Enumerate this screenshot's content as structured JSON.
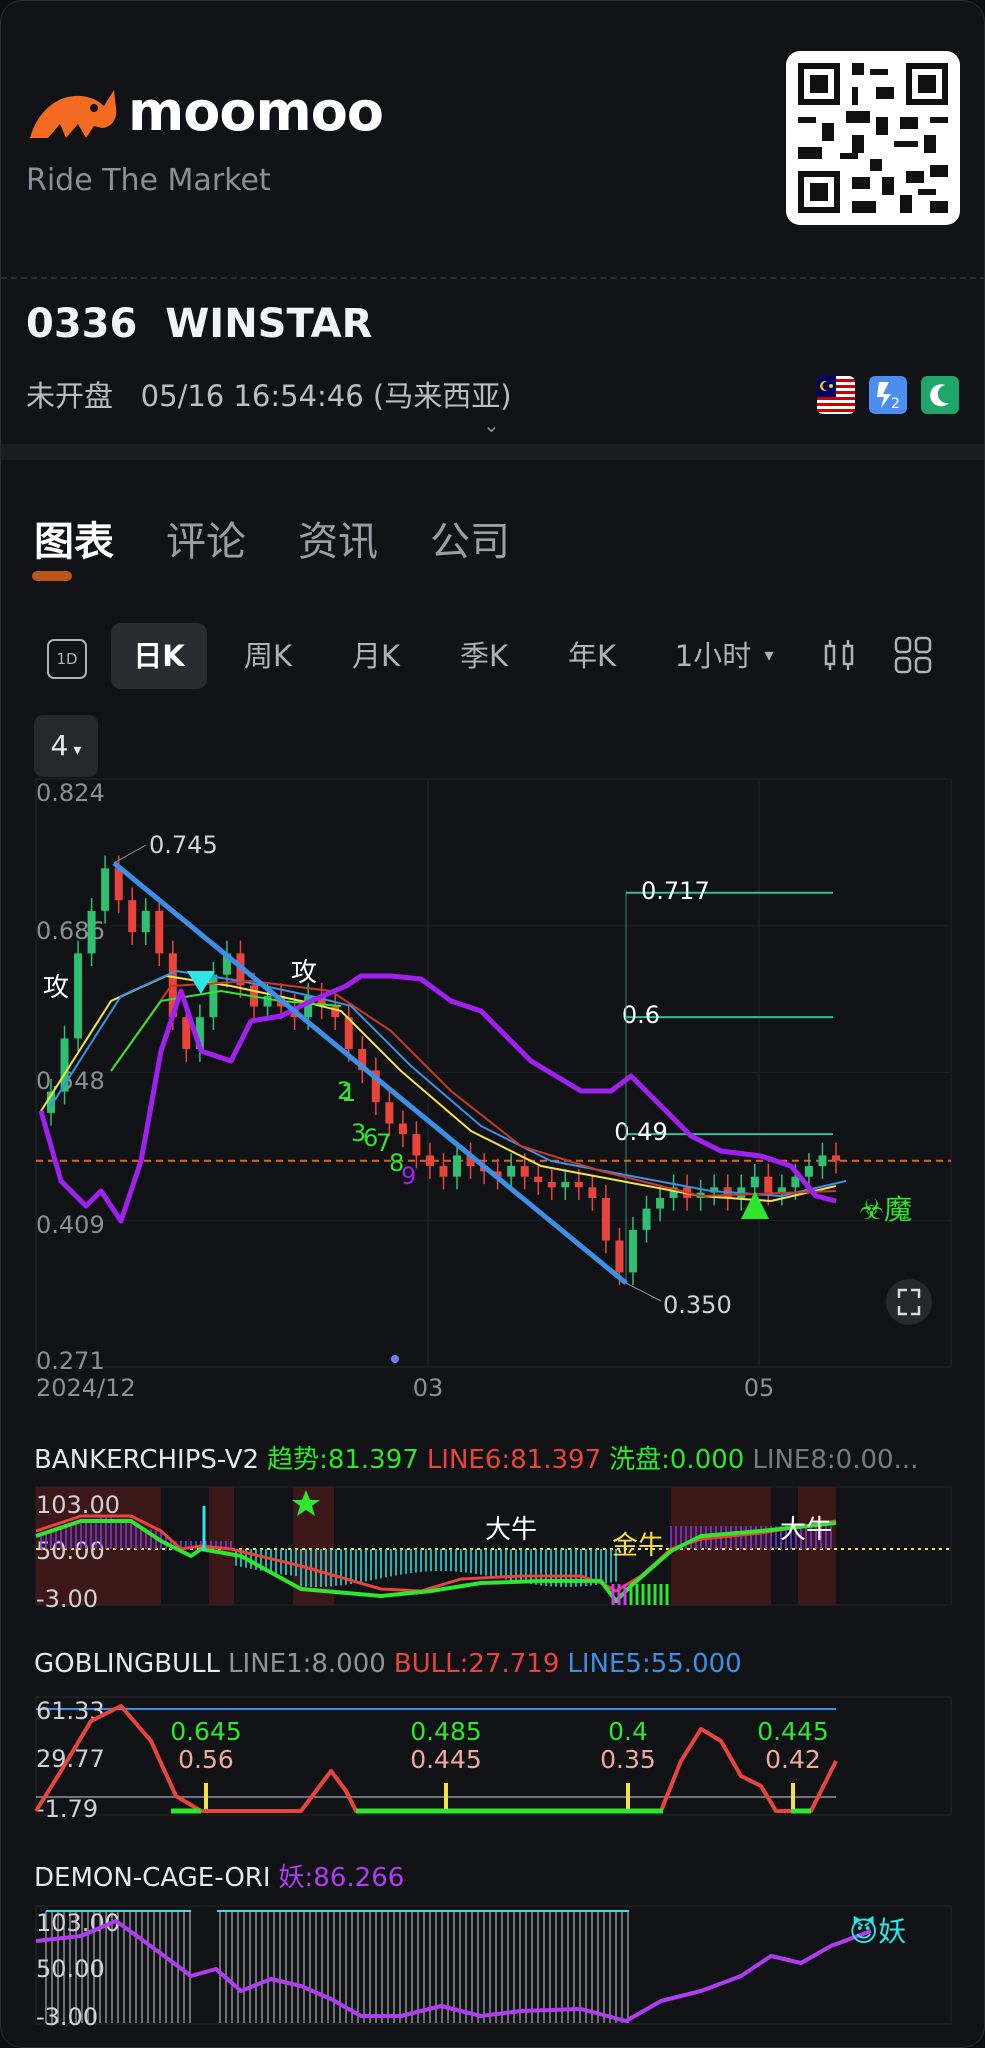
{
  "brand": {
    "name": "moomoo",
    "slogan": "Ride The Market"
  },
  "stock": {
    "code": "0336",
    "name": "WINSTAR",
    "status": "未开盘",
    "time": "05/16 16:54:46 (马来西亚)"
  },
  "tabs": [
    "图表",
    "评论",
    "资讯",
    "公司"
  ],
  "period_tabs": [
    "日K",
    "周K",
    "月K",
    "季K",
    "年K",
    "1小时"
  ],
  "oned_label": "1D",
  "indicator_count": "4",
  "colors": {
    "up": "#2fbf71",
    "down": "#e8443c",
    "accent": "#d8621f",
    "purple": "#a020f0",
    "green": "#2ee62e",
    "blue": "#3d8fe6",
    "yellow": "#f5e14a"
  },
  "chart_data": [
    {
      "type": "line",
      "title": "",
      "y_ticks": [
        "0.824",
        "0.686",
        "0.548",
        "0.409",
        "0.271"
      ],
      "x_ticks": [
        "2024/12",
        "03",
        "05"
      ],
      "ylim": [
        0.271,
        0.824
      ],
      "annotations": {
        "high": "0.745",
        "low": "0.350",
        "levels": [
          "0.717",
          "0.6",
          "0.49"
        ],
        "attack": [
          "攻",
          "攻"
        ],
        "count": [
          "1",
          "2",
          "3",
          "6",
          "7",
          "8",
          "9"
        ],
        "demon": "☣魔"
      },
      "price_line": 0.465
    },
    {
      "type": "area",
      "title": "BANKERCHIPS-V2",
      "legend": [
        {
          "name": "趋势:81.397",
          "color": "#2ee62e"
        },
        {
          "name": "LINE6:81.397",
          "color": "#e8443c"
        },
        {
          "name": "洗盘:0.000",
          "color": "#2ee62e"
        },
        {
          "name": "LINE8:0.00...",
          "color": "#777a80"
        }
      ],
      "y_ticks": [
        "103.00",
        "50.00",
        "-3.00"
      ],
      "labels": [
        "大牛",
        "金牛",
        "大牛"
      ]
    },
    {
      "type": "line",
      "title": "GOBLINGBULL",
      "legend": [
        {
          "name": "LINE1:8.000",
          "color": "#8f9298"
        },
        {
          "name": "BULL:27.719",
          "color": "#e8443c"
        },
        {
          "name": "LINE5:55.000",
          "color": "#3d8fe6"
        }
      ],
      "y_ticks": [
        "61.33",
        "29.77",
        "-1.79"
      ],
      "signals": [
        {
          "top": "0.645",
          "bottom": "0.56"
        },
        {
          "top": "0.485",
          "bottom": "0.445"
        },
        {
          "top": "0.4",
          "bottom": "0.35"
        },
        {
          "top": "0.445",
          "bottom": "0.42"
        }
      ]
    },
    {
      "type": "line",
      "title": "DEMON-CAGE-ORI",
      "legend": [
        {
          "name": "妖:86.266",
          "color": "#b03cf0"
        }
      ],
      "y_ticks": [
        "103.00",
        "50.00",
        "-3.00"
      ],
      "label": "😈妖"
    }
  ]
}
